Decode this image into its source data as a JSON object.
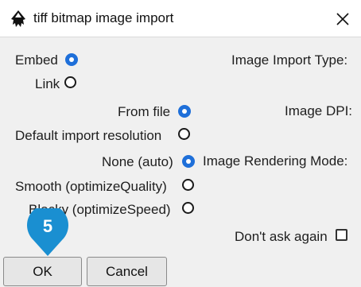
{
  "window": {
    "title": "tiff bitmap image import",
    "app_icon": "inkscape-icon",
    "close_icon": "close-icon"
  },
  "import_type": {
    "label": "Image Import Type:",
    "options": [
      {
        "label": "Embed",
        "selected": true
      },
      {
        "label": "Link",
        "selected": false
      }
    ]
  },
  "image_dpi": {
    "label": "Image DPI:",
    "options": [
      {
        "label": "From file",
        "selected": true
      },
      {
        "label": "Default import resolution",
        "selected": false
      }
    ]
  },
  "rendering_mode": {
    "label": "Image Rendering Mode:",
    "options": [
      {
        "label": "None (auto)",
        "selected": true
      },
      {
        "label": "Smooth (optimizeQuality)",
        "selected": false
      },
      {
        "label": "Blocky (optimizeSpeed)",
        "selected": false
      }
    ]
  },
  "dont_ask": {
    "label": "Don't ask again",
    "checked": false
  },
  "buttons": {
    "ok": "OK",
    "cancel": "Cancel"
  },
  "step_badge": {
    "number": "5",
    "color": "#1a8fd1"
  },
  "colors": {
    "accent": "#1e6fd9",
    "background": "#f0f0f0"
  }
}
